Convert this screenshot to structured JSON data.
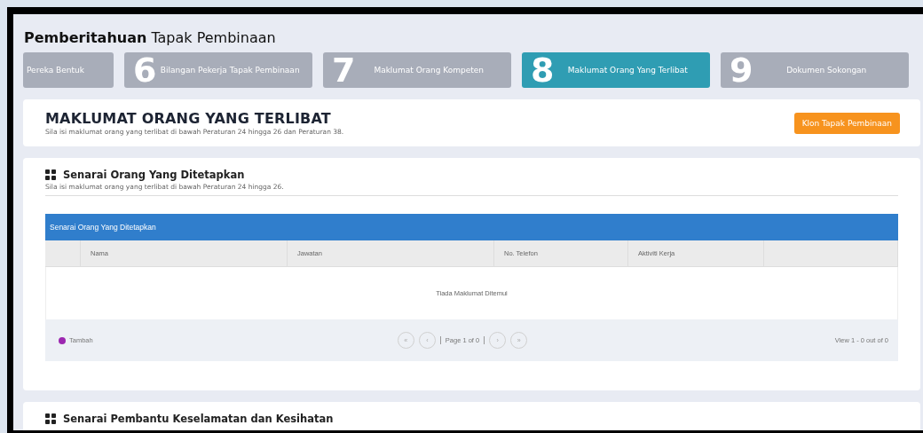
{
  "page_title": {
    "bold": "Pemberitahuan",
    "rest": "Tapak Pembinaan"
  },
  "steps": [
    {
      "label": "Pereka Bentuk",
      "selected": false
    },
    {
      "number": "6",
      "label": "Bilangan Pekerja Tapak Pembinaan",
      "selected": false
    },
    {
      "number": "7",
      "label": "Maklumat Orang Kompeten",
      "selected": false
    },
    {
      "number": "8",
      "label": "Maklumat Orang Yang Terlibat",
      "selected": true
    },
    {
      "number": "9",
      "label": "Dokumen Sokongan",
      "selected": false
    }
  ],
  "header_card": {
    "title": "MAKLUMAT ORANG YANG TERLIBAT",
    "subtitle": "Sila isi maklumat orang yang terlibat di bawah Peraturan 24 hingga 26 dan Peraturan 38.",
    "button": "Klon Tapak Pembinaan"
  },
  "sections": [
    {
      "title": "Senarai Orang Yang Ditetapkan",
      "subtitle": "Sila isi maklumat orang yang terlibat di bawah Peraturan 24 hingga 26.",
      "table": {
        "caption": "Senarai Orang Yang Ditetapkan",
        "columns": [
          "",
          "Nama",
          "Jawatan",
          "No. Telefon",
          "Aktiviti Kerja",
          ""
        ],
        "empty_message": "Tiada Maklumat Ditemui",
        "footer": {
          "add": "Tambah",
          "pager_first": "«",
          "pager_prev": "‹",
          "page": "Page 1 of 0",
          "pager_next": "›",
          "pager_last": "»",
          "view": "View 1 - 0 out of 0"
        }
      }
    },
    {
      "title": "Senarai Pembantu Keselamatan dan Kesihatan"
    }
  ]
}
